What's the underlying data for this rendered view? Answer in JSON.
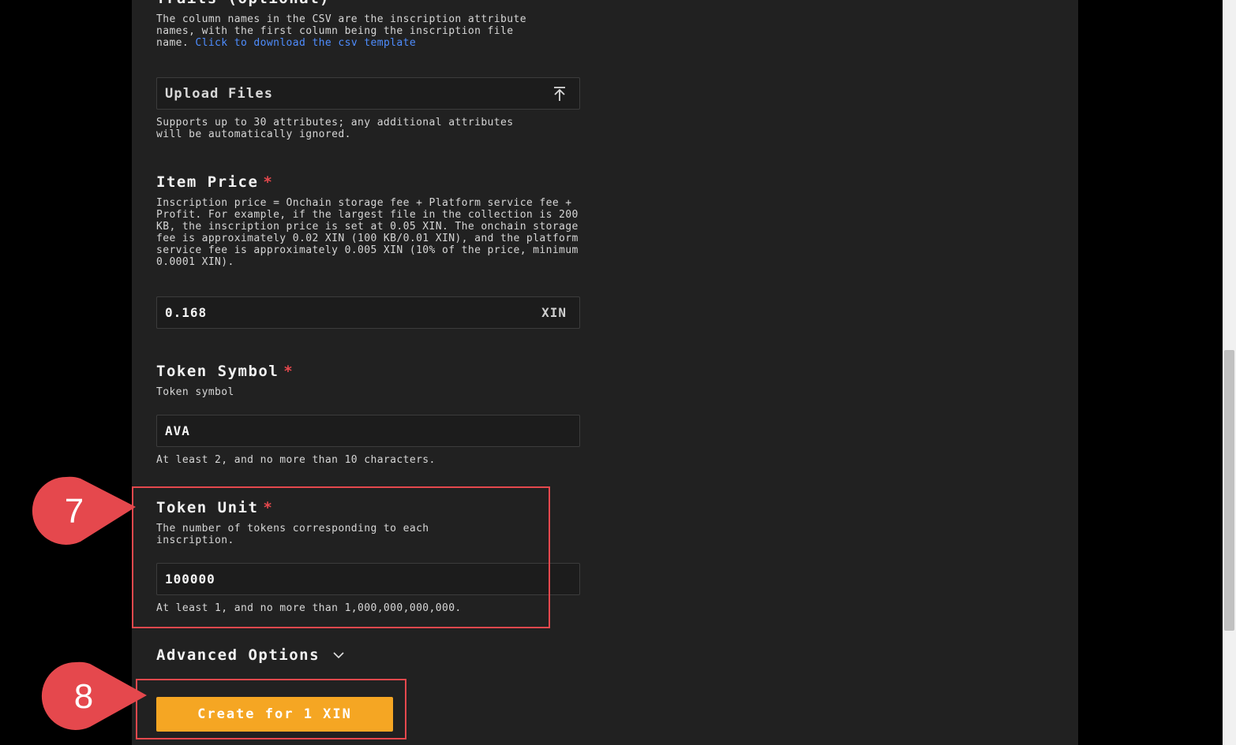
{
  "traits": {
    "title_partial": "Traits (optional)",
    "desc_text": "The column names in the CSV are the inscription attribute names, with the first column being the inscription file name.",
    "link_text": "Click to download the csv template",
    "upload_label": "Upload Files",
    "upload_icon": "upload-icon",
    "hint": "Supports up to 30 attributes; any additional attributes will be automatically ignored."
  },
  "item_price": {
    "title": "Item Price",
    "required": "*",
    "desc": "Inscription price = Onchain storage fee + Platform service fee + Profit. For example, if the largest file in the collection is 200 KB, the inscription price is set at 0.05 XIN. The onchain storage fee is approximately 0.02 XIN (100 KB/0.01 XIN), and the platform service fee is approximately 0.005 XIN (10% of the price, minimum 0.0001 XIN).",
    "value": "0.168",
    "unit": "XIN"
  },
  "token_symbol": {
    "title": "Token Symbol",
    "required": "*",
    "desc": "Token symbol",
    "value": "AVA",
    "hint": "At least 2, and no more than 10 characters."
  },
  "token_unit": {
    "title": "Token Unit",
    "required": "*",
    "desc": "The number of tokens corresponding to each inscription.",
    "value": "100000",
    "hint": "At least 1, and no more than 1,000,000,000,000."
  },
  "advanced": {
    "label": "Advanced Options",
    "icon": "chevron-down-icon"
  },
  "create_button": {
    "label": "Create for 1 XIN"
  },
  "annotations": {
    "step7": "7",
    "step8": "8",
    "color": "#e5484d"
  }
}
